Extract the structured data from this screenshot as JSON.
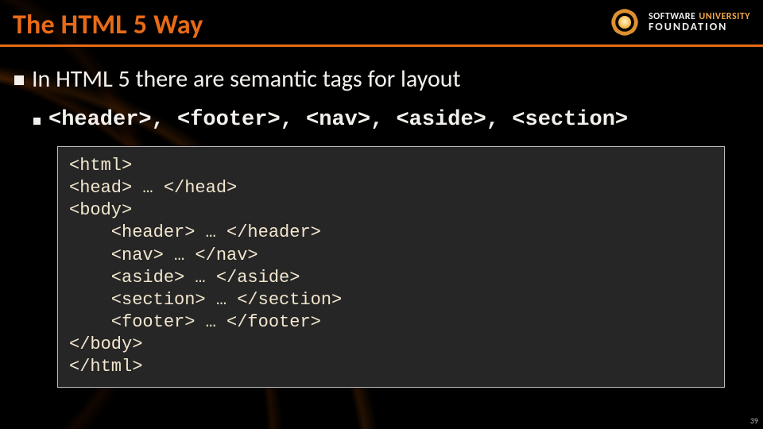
{
  "title": "The HTML 5 Way",
  "logo": {
    "line1_a": "SOFTWARE",
    "line1_b": "UNIVERSITY",
    "line2": "FOUNDATION"
  },
  "bullets": {
    "level1": "In HTML 5 there are semantic tags for layout",
    "level2": "<header>, <footer>, <nav>, <aside>, <section>"
  },
  "code": "<html>\n<head> … </head>\n<body>\n    <header> … </header>\n    <nav> … </nav>\n    <aside> … </aside>\n    <section> … </section>\n    <footer> … </footer>\n</body>\n</html>",
  "page_number": "39"
}
